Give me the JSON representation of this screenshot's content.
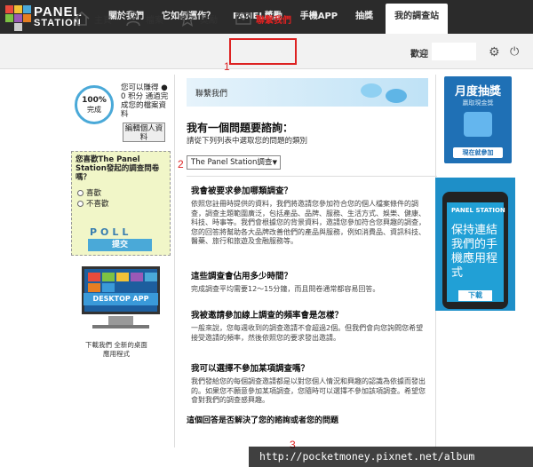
{
  "logo": {
    "line1": "PANEL",
    "line2": "STATION"
  },
  "top_nav": {
    "items": [
      "關於我們",
      "它如何運作？",
      "PANEL獎勵",
      "手機APP",
      "抽獎",
      "我的調查站"
    ]
  },
  "sub_nav": {
    "home": "主頁",
    "files": "檔案",
    "rewards": "獎勵",
    "contact": "聯繫我們",
    "welcome": "歡迎"
  },
  "markers": {
    "m1": "1",
    "m2": "2",
    "m3": "3"
  },
  "profile": {
    "percent": "100%",
    "done": "完成",
    "text": "您可以賺得 ● 0 积分 通過完成您的檔案資料",
    "edit_button": "編輯個人資料"
  },
  "poll": {
    "question": "您喜歡The Panel Station發起的調查問卷嗎？",
    "options": [
      "喜歡",
      "不喜歡"
    ],
    "logo": "POLL",
    "submit": "提交"
  },
  "desktop_app": {
    "label": "DESKTOP APP",
    "download": "下載我們 全新的桌面應用程式"
  },
  "main": {
    "banner": "聯繫我們",
    "title": "我有一個問題要諮詢：",
    "subtitle": "請從下列列表中選取您的問題的類別",
    "select_value": "The Panel Station調查"
  },
  "faq": [
    {
      "q": "我會被要求參加哪類調查？",
      "a": "依照您註冊時提供的資料，我們將邀請您參加符合您的個人檔案條件的調查，調查主題範圍廣泛，包括產品、品牌、服務、生活方式、娛樂、健康、科技、時事等。我們會根據您的背景資料，邀請您參加符合您興趣的調查，您的回答將幫助各大品牌改善他們的產品與服務，例如消費品、資訊科技、醫藥、旅行和旅遊及金融服務等。"
    },
    {
      "q": "這些調查會佔用多少時間？",
      "a": "完成調查平均需要12～15分鐘，而且問卷通常都容易回答。"
    },
    {
      "q": "我被邀請參加線上調查的頻率會是怎樣？",
      "a": "一般來說，您每週收到的調查邀請不會超過2個。但我們會向您詢問您希望接受邀請的頻率，然後依照您的要求發出邀請。"
    },
    {
      "q": "我可以選擇不參加某項調查嗎？",
      "a": "我們發給您的每個調查邀請都是以對您個人情況和興趣的認識為依據而發出的。如果您不願意參加某項調查，您隨時可以選擇不參加該項調查。希望您會對我們的調查感興趣。"
    }
  ],
  "helpful": "這個回答是否解決了您的諮詢或者您的問題",
  "ad_lottery": {
    "title": "月度抽獎",
    "subtitle": "贏取現金獎",
    "button": "現在就參加"
  },
  "ad_mobile": {
    "brand": "PANEL STATION",
    "text": "保持連結我們的手機應用程式",
    "button": "下載"
  },
  "watermark": "http://pocketmoney.pixnet.net/album",
  "colors": {
    "accent": "#4aa9d8",
    "marker": "#dd2222",
    "topbar": "#2b2b2b"
  }
}
